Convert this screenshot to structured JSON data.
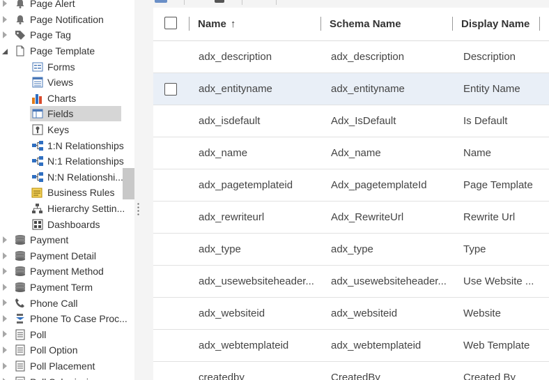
{
  "tree": {
    "items": [
      {
        "label": "Page Alert",
        "icon": "bell-icon",
        "level": 0,
        "expander": "collapsed"
      },
      {
        "label": "Page Notification",
        "icon": "bell-icon",
        "level": 0,
        "expander": "collapsed"
      },
      {
        "label": "Page Tag",
        "icon": "tag-icon",
        "level": 0,
        "expander": "collapsed"
      },
      {
        "label": "Page Template",
        "icon": "page-icon",
        "level": 0,
        "expander": "expanded"
      },
      {
        "label": "Forms",
        "icon": "form-icon",
        "level": 1
      },
      {
        "label": "Views",
        "icon": "views-icon",
        "level": 1
      },
      {
        "label": "Charts",
        "icon": "chart-icon",
        "level": 1
      },
      {
        "label": "Fields",
        "icon": "fields-icon",
        "level": 1,
        "selected": true
      },
      {
        "label": "Keys",
        "icon": "key-icon",
        "level": 1
      },
      {
        "label": "1:N Relationships",
        "icon": "relationship-icon",
        "level": 1
      },
      {
        "label": "N:1 Relationships",
        "icon": "relationship-icon",
        "level": 1
      },
      {
        "label": "N:N Relationshi...",
        "icon": "relationship-icon",
        "level": 1
      },
      {
        "label": "Business Rules",
        "icon": "business-rule-icon",
        "level": 1
      },
      {
        "label": "Hierarchy Settin...",
        "icon": "hierarchy-icon",
        "level": 1
      },
      {
        "label": "Dashboards",
        "icon": "dashboard-icon",
        "level": 1
      },
      {
        "label": "Payment",
        "icon": "entity-icon",
        "level": 0,
        "expander": "collapsed"
      },
      {
        "label": "Payment Detail",
        "icon": "entity-icon",
        "level": 0,
        "expander": "collapsed"
      },
      {
        "label": "Payment Method",
        "icon": "entity-icon",
        "level": 0,
        "expander": "collapsed"
      },
      {
        "label": "Payment Term",
        "icon": "entity-icon",
        "level": 0,
        "expander": "collapsed"
      },
      {
        "label": "Phone Call",
        "icon": "phone-icon",
        "level": 0,
        "expander": "collapsed"
      },
      {
        "label": "Phone To Case Proc...",
        "icon": "process-icon",
        "level": 0,
        "expander": "collapsed"
      },
      {
        "label": "Poll",
        "icon": "list-icon",
        "level": 0,
        "expander": "collapsed"
      },
      {
        "label": "Poll Option",
        "icon": "list-icon",
        "level": 0,
        "expander": "collapsed"
      },
      {
        "label": "Poll Placement",
        "icon": "list-icon",
        "level": 0,
        "expander": "collapsed"
      },
      {
        "label": "Poll Submission",
        "icon": "list-icon",
        "level": 0,
        "expander": "collapsed"
      }
    ]
  },
  "grid": {
    "columns": {
      "name": "Name",
      "sort_indicator": "↑",
      "schema": "Schema Name",
      "display": "Display Name"
    },
    "rows": [
      {
        "name": "adx_description",
        "schema": "adx_description",
        "display": "Description"
      },
      {
        "name": "adx_entityname",
        "schema": "adx_entityname",
        "display": "Entity Name",
        "highlighted": true
      },
      {
        "name": "adx_isdefault",
        "schema": "Adx_IsDefault",
        "display": "Is Default"
      },
      {
        "name": "adx_name",
        "schema": "Adx_name",
        "display": "Name"
      },
      {
        "name": "adx_pagetemplateid",
        "schema": "Adx_pagetemplateId",
        "display": "Page Template"
      },
      {
        "name": "adx_rewriteurl",
        "schema": "Adx_RewriteUrl",
        "display": "Rewrite Url"
      },
      {
        "name": "adx_type",
        "schema": "adx_type",
        "display": "Type"
      },
      {
        "name": "adx_usewebsiteheader...",
        "schema": "adx_usewebsiteheader...",
        "display": "Use Website ..."
      },
      {
        "name": "adx_websiteid",
        "schema": "adx_websiteid",
        "display": "Website"
      },
      {
        "name": "adx_webtemplateid",
        "schema": "adx_webtemplateid",
        "display": "Web Template"
      },
      {
        "name": "createdby",
        "schema": "CreatedBy",
        "display": "Created By"
      }
    ]
  },
  "colors": {
    "selected_bg": "#d6d6d6",
    "row_highlight": "#e9eff7",
    "splitter": "#f4f4f4"
  }
}
